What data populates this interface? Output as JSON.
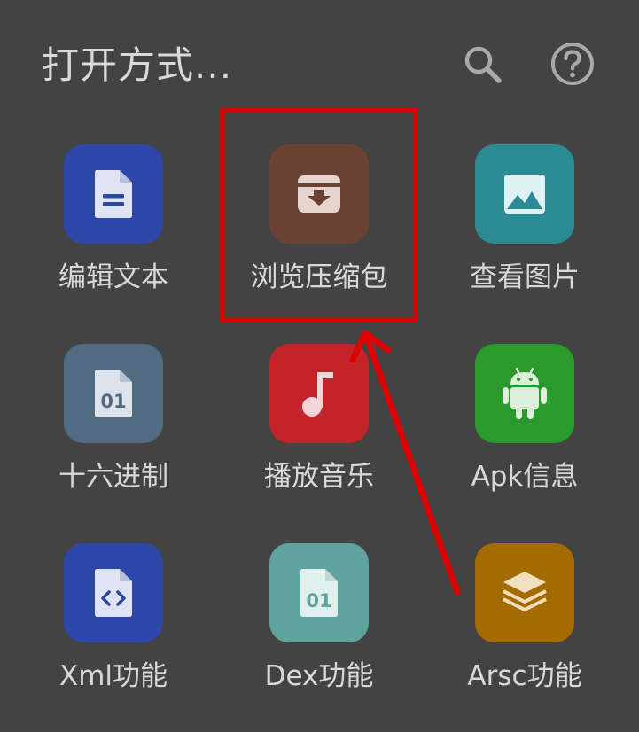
{
  "header": {
    "title": "打开方式...",
    "search_icon": "search-icon",
    "help_icon": "help-icon"
  },
  "apps": [
    {
      "label": "编辑文本",
      "icon": "text-document-icon",
      "color": "#2c47a8"
    },
    {
      "label": "浏览压缩包",
      "icon": "archive-box-icon",
      "color": "#6a4234"
    },
    {
      "label": "查看图片",
      "icon": "image-icon",
      "color": "#2b8b95"
    },
    {
      "label": "十六进制",
      "icon": "binary-file-icon",
      "color": "#526b82"
    },
    {
      "label": "播放音乐",
      "icon": "music-note-icon",
      "color": "#c32429"
    },
    {
      "label": "Apk信息",
      "icon": "android-icon",
      "color": "#2a9a2d"
    },
    {
      "label": "Xml功能",
      "icon": "code-file-icon",
      "color": "#2c47a8"
    },
    {
      "label": "Dex功能",
      "icon": "binary-file-icon",
      "color": "#5ea39d"
    },
    {
      "label": "Arsc功能",
      "icon": "layers-icon",
      "color": "#a56b00"
    }
  ],
  "annotation": {
    "highlight_color": "#e00000",
    "arrow_color": "#e00000"
  }
}
